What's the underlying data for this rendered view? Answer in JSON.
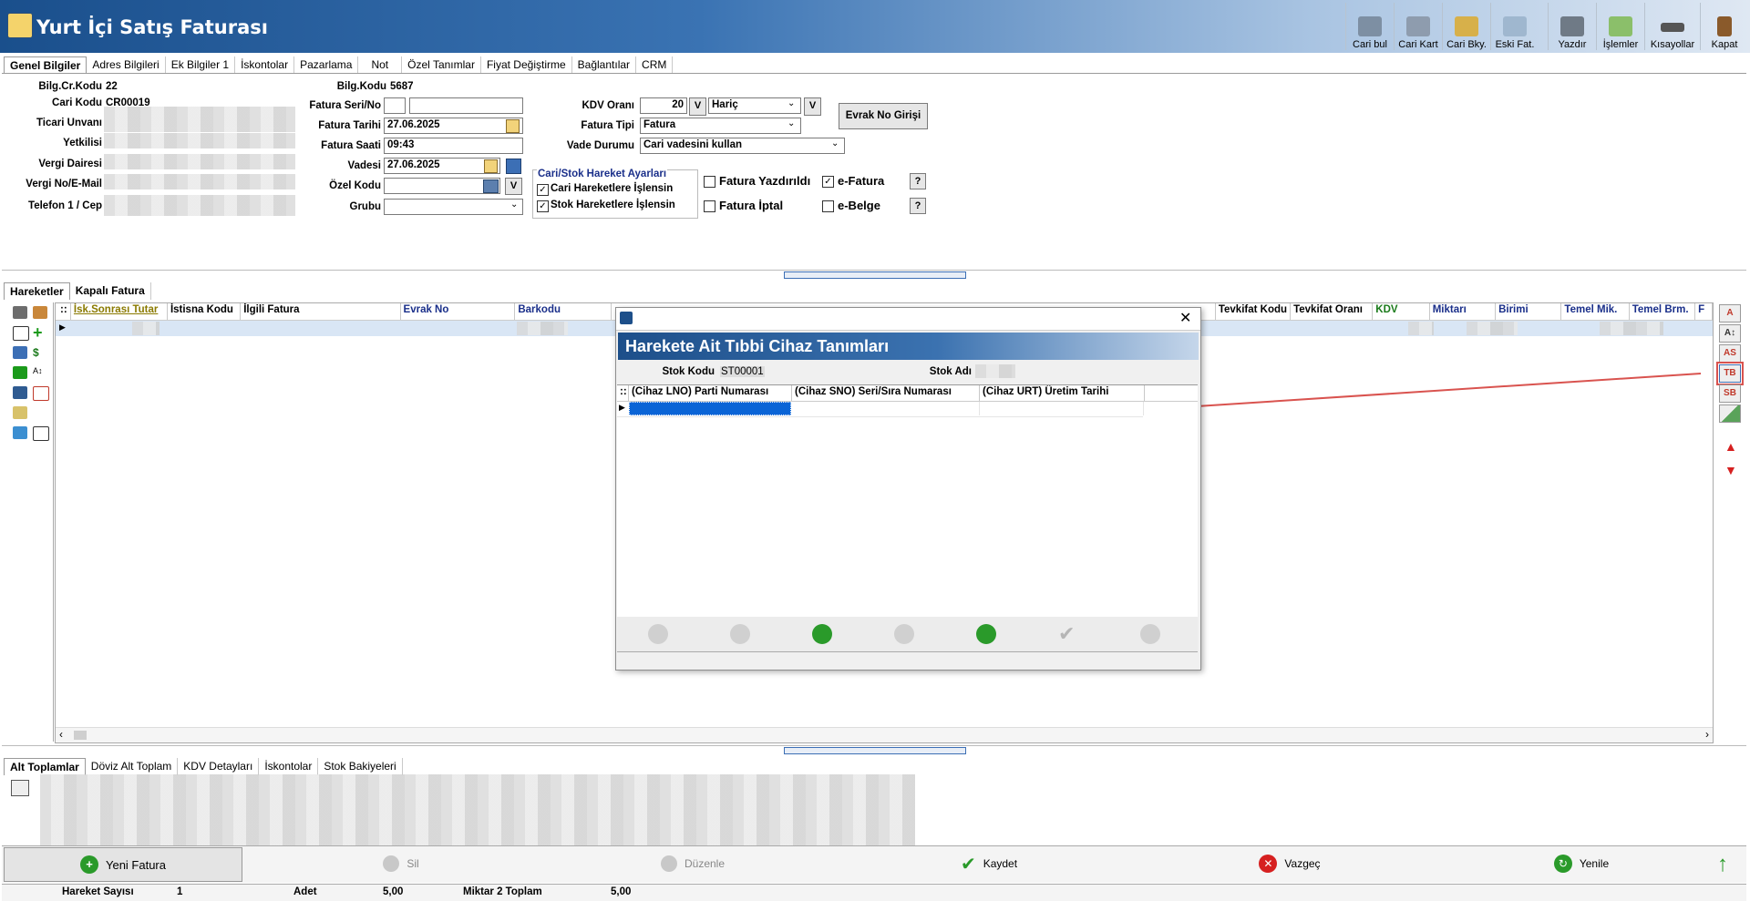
{
  "app": {
    "title": "Yurt İçi Satış Faturası"
  },
  "toolbar": [
    {
      "label": "Cari bul",
      "icon": "person-search-icon"
    },
    {
      "label": "Cari Kart",
      "icon": "person-card-icon"
    },
    {
      "label": "Cari Bky.",
      "icon": "person-balance-icon"
    },
    {
      "label": "Eski Fat.",
      "icon": "old-invoice-icon"
    },
    {
      "label": "Yazdır",
      "icon": "printer-icon"
    },
    {
      "label": "İşlemler",
      "icon": "operations-icon"
    },
    {
      "label": "Kısayollar",
      "icon": "keyboard-icon"
    },
    {
      "label": "Kapat",
      "icon": "door-exit-icon"
    }
  ],
  "tabs": [
    "Genel Bilgiler",
    "Adres Bilgileri",
    "Ek Bilgiler 1",
    "İskontolar",
    "Pazarlama",
    "Not",
    "Özel Tanımlar",
    "Fiyat Değiştirme",
    "Bağlantılar",
    "CRM"
  ],
  "form": {
    "bilg_cr_kodu_label": "Bilg.Cr.Kodu",
    "bilg_cr_kodu": "22",
    "cari_kodu_label": "Cari Kodu",
    "cari_kodu": "CR00019",
    "ticari_unvan_label": "Ticari Unvanı",
    "yetkilisi_label": "Yetkilisi",
    "vergi_dairesi_label": "Vergi Dairesi",
    "vergi_no_label": "Vergi No/E-Mail",
    "telefon_label": "Telefon 1 / Cep",
    "bilg_kodu_label": "Bilg.Kodu",
    "bilg_kodu": "5687",
    "fatura_seri_label": "Fatura Seri/No",
    "fatura_tarihi_label": "Fatura Tarihi",
    "fatura_tarihi": "27.06.2025",
    "fatura_saati_label": "Fatura Saati",
    "fatura_saati": "09:43",
    "vadesi_label": "Vadesi",
    "vadesi": "27.06.2025",
    "ozel_kodu_label": "Özel Kodu",
    "grubu_label": "Grubu",
    "kdv_orani_label": "KDV Oranı",
    "kdv_orani": "20",
    "kdv_v": "V",
    "kdv_dahil": "Hariç",
    "kdv_dahil_v": "V",
    "evrak_no_btn": "Evrak No Girişi",
    "fatura_tipi_label": "Fatura Tipi",
    "fatura_tipi": "Fatura",
    "vade_durumu_label": "Vade Durumu",
    "vade_durumu": "Cari vadesini kullan",
    "hareket_ayarlari_title": "Cari/Stok Hareket Ayarları",
    "cari_hareket_label": "Cari Hareketlere İşlensin",
    "stok_hareket_label": "Stok Hareketlere İşlensin",
    "fatura_yazdirildi": "Fatura Yazdırıldı",
    "fatura_iptal": "Fatura İptal",
    "e_fatura": "e-Fatura",
    "e_belge": "e-Belge",
    "help": "?"
  },
  "mid_tabs": [
    "Hareketler",
    "Kapalı Fatura"
  ],
  "grid_headers": [
    {
      "label": "İsk.Sonrası Tutar",
      "color": "#8a7a00"
    },
    {
      "label": "İstisna Kodu",
      "color": "#000"
    },
    {
      "label": "İlgili Fatura",
      "color": "#000"
    },
    {
      "label": "Evrak No",
      "color": "#1a2f8a"
    },
    {
      "label": "Barkodu",
      "color": "#1a2f8a"
    },
    {
      "label": "Tevkifat Kodu",
      "color": "#000"
    },
    {
      "label": "Tevkifat Oranı",
      "color": "#000"
    },
    {
      "label": "KDV",
      "color": "#1a7a1a"
    },
    {
      "label": "Miktarı",
      "color": "#1a2f8a"
    },
    {
      "label": "Birimi",
      "color": "#1a2f8a"
    },
    {
      "label": "Temel Mik.",
      "color": "#1a2f8a"
    },
    {
      "label": "Temel Brm.",
      "color": "#1a2f8a"
    },
    {
      "label": "F",
      "color": "#1a2f8a"
    }
  ],
  "right_buttons": [
    "A",
    "A↕",
    "AS",
    "TB",
    "SB"
  ],
  "dialog": {
    "title": "Harekete Ait Tıbbi Cihaz Tanımları",
    "stok_kodu_label": "Stok Kodu",
    "stok_kodu": "ST00001",
    "stok_adi_label": "Stok Adı",
    "columns": [
      "(Cihaz LNO) Parti Numarası",
      "(Cihaz SNO) Seri/Sıra Numarası",
      "(Cihaz URT) Üretim Tarihi"
    ]
  },
  "bottom_tabs": [
    "Alt Toplamlar",
    "Döviz Alt Toplam",
    "KDV Detayları",
    "İskontolar",
    "Stok Bakiyeleri"
  ],
  "actions": {
    "yeni_fatura": "Yeni Fatura",
    "sil": "Sil",
    "duzenle": "Düzenle",
    "kaydet": "Kaydet",
    "vazgec": "Vazgeç",
    "yenile": "Yenile"
  },
  "status": {
    "hareket_sayisi_label": "Hareket Sayısı",
    "hareket_sayisi": "1",
    "adet_label": "Adet",
    "adet": "5,00",
    "miktar2_label": "Miktar 2 Toplam",
    "miktar2": "5,00"
  },
  "colors": {
    "accent": "#1d4f8a",
    "highlight_red": "#d9534f",
    "selection": "#0a64d6"
  }
}
